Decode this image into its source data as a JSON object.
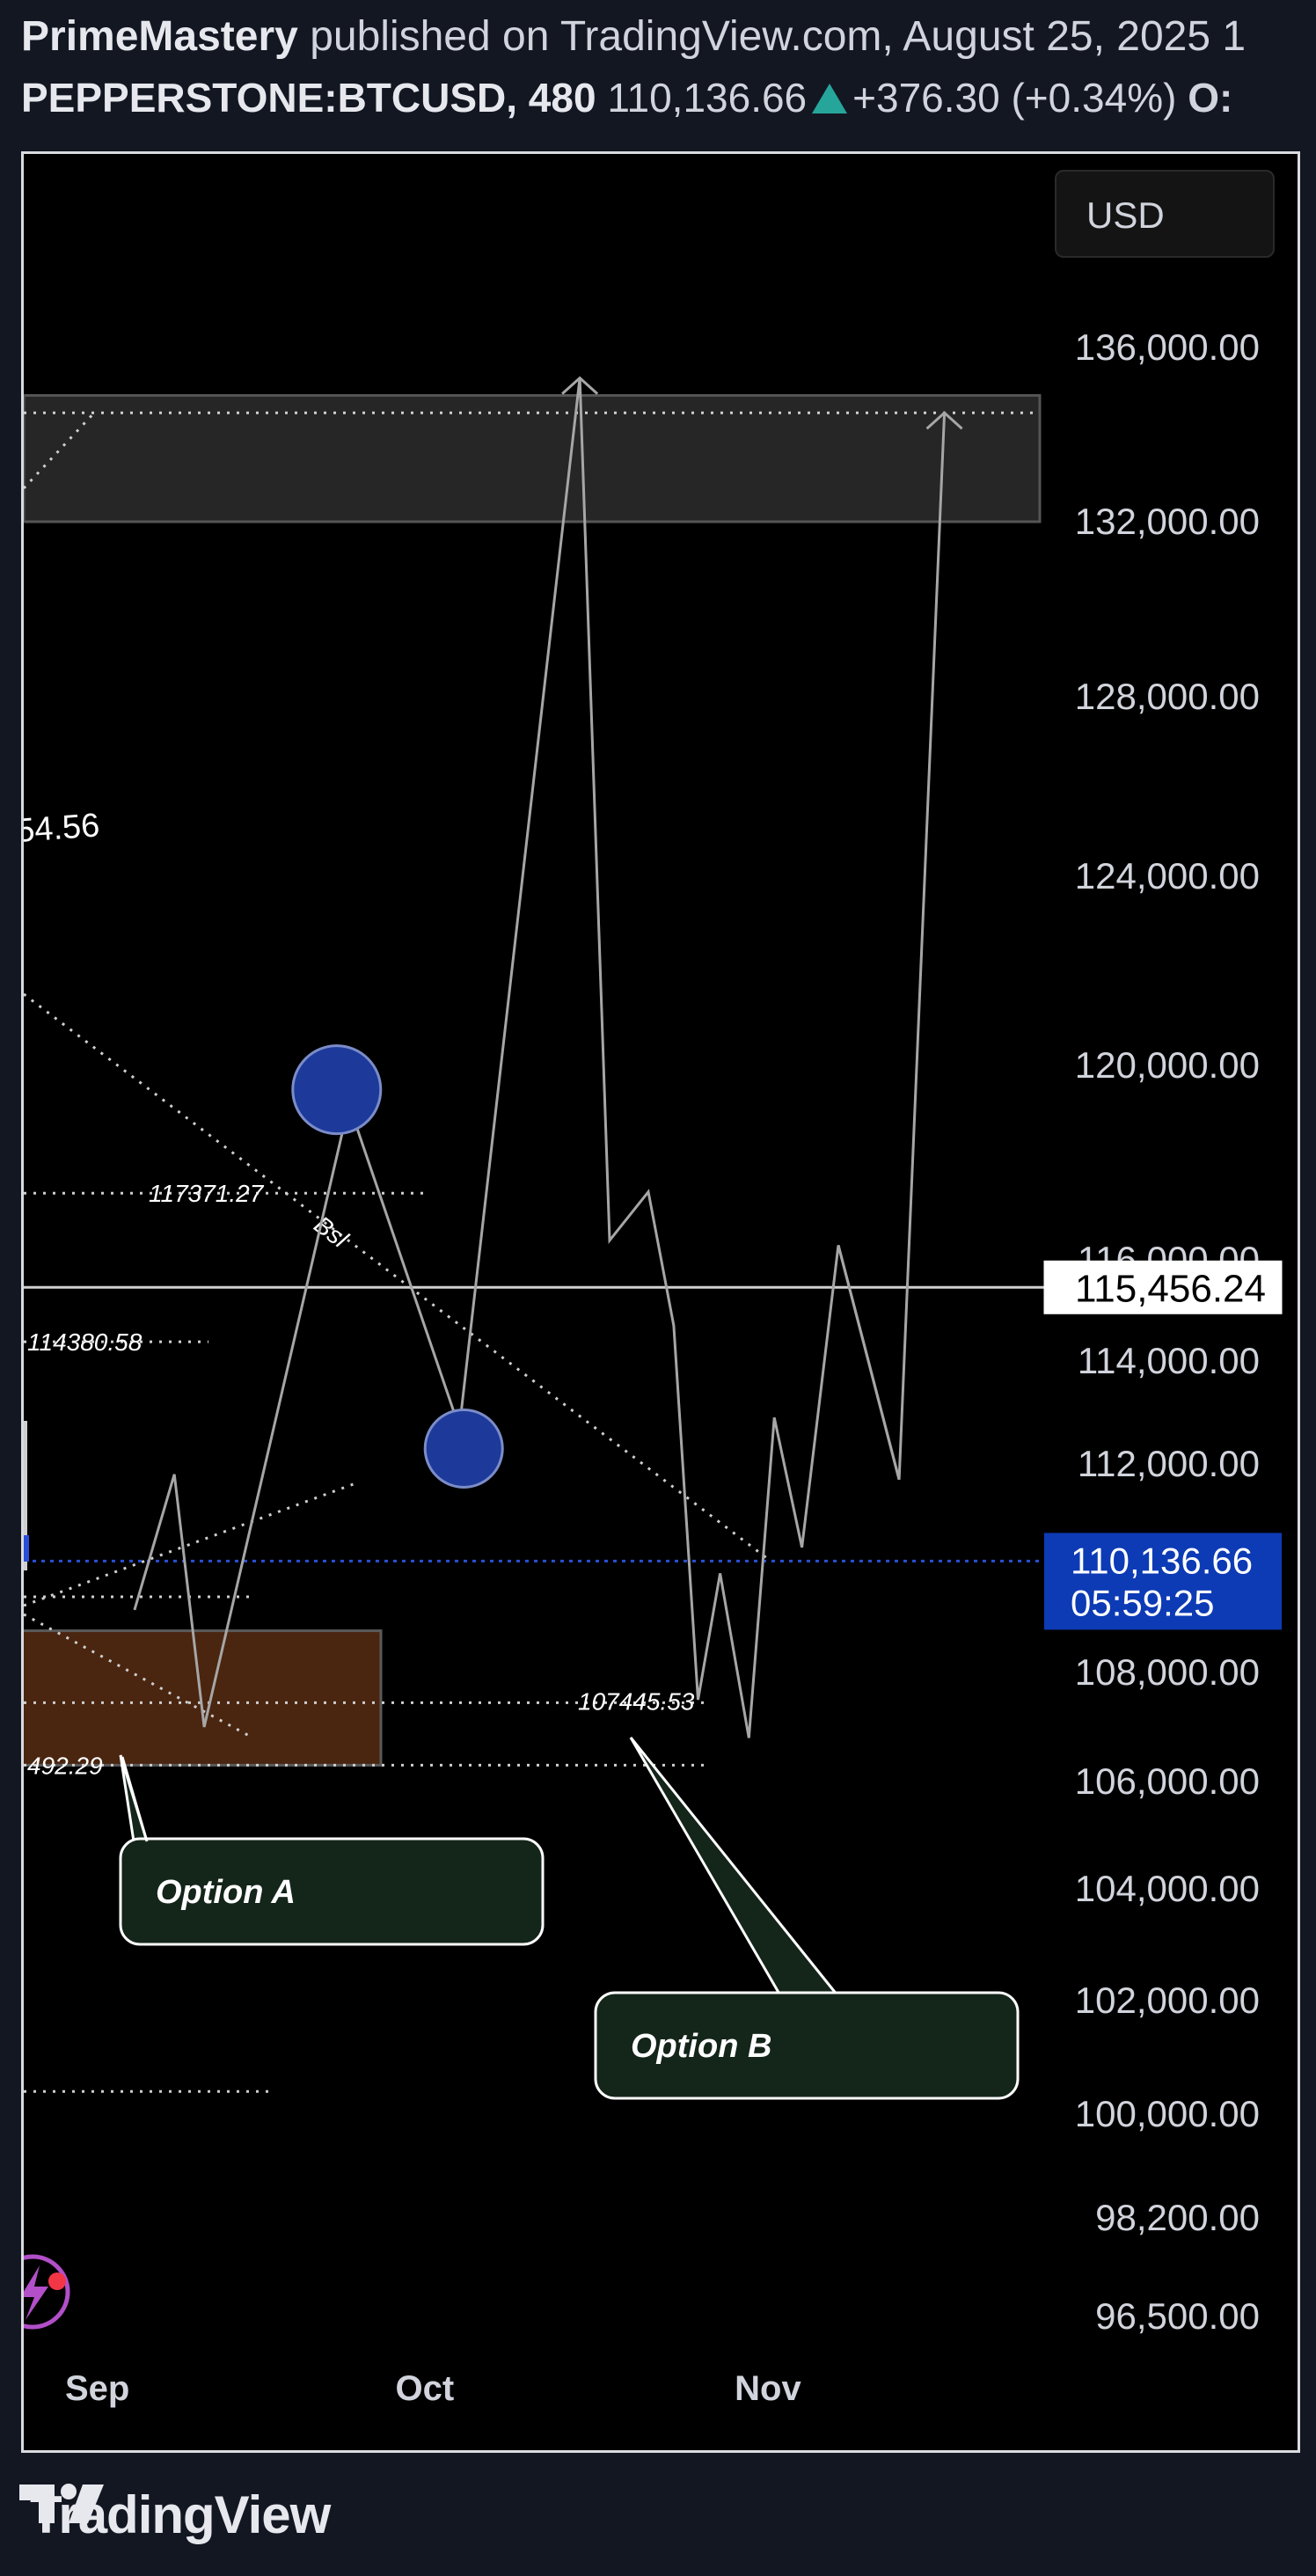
{
  "header": {
    "author": "PrimeMastery",
    "published_text": "published on TradingView.com, August 25, 2025 1",
    "symbol_interval": "PEPPERSTONE:BTCUSD, 480",
    "last_price": "110,136.66",
    "change": "+376.30 (+0.34%)",
    "ohlc_label": "O:"
  },
  "price_axis": {
    "unit": "USD",
    "labels": [
      {
        "text": "136,000.00",
        "value": 136000
      },
      {
        "text": "132,000.00",
        "value": 132000
      },
      {
        "text": "128,000.00",
        "value": 128000
      },
      {
        "text": "124,000.00",
        "value": 124000
      },
      {
        "text": "120,000.00",
        "value": 120000
      },
      {
        "text": "116,000.00",
        "value": 116000
      },
      {
        "text": "114,000.00",
        "value": 114000
      },
      {
        "text": "112,000.00",
        "value": 112000
      },
      {
        "text": "108,000.00",
        "value": 108000
      },
      {
        "text": "106,000.00",
        "value": 106000
      },
      {
        "text": "104,000.00",
        "value": 104000
      },
      {
        "text": "102,000.00",
        "value": 102000
      },
      {
        "text": "100,000.00",
        "value": 100000
      },
      {
        "text": "98,200.00",
        "value": 98200
      },
      {
        "text": "96,500.00",
        "value": 96500
      }
    ],
    "level_tag": {
      "text": "115,456.24",
      "value": 115456.24
    },
    "price_tag": {
      "price": "110,136.66",
      "countdown": "05:59:25",
      "value": 110136.66,
      "color": "#0d3bb5"
    }
  },
  "time_axis": {
    "labels": [
      {
        "text": "Sep",
        "t": 0.9
      },
      {
        "text": "Oct",
        "t": 30.8
      },
      {
        "text": "Nov",
        "t": 61.5
      }
    ]
  },
  "chart_data": {
    "type": "line",
    "series": [
      {
        "x": [
          4,
          7.6,
          10.3,
          23.4,
          33.4,
          44.3,
          47,
          50.5,
          52.8,
          55,
          57,
          59.6,
          61.9,
          64.4,
          67.7,
          73.2
        ],
        "y": [
          109200,
          111800,
          107000,
          119200,
          112700,
          135300,
          116400,
          117400,
          114700,
          107500,
          109900,
          106800,
          112900,
          110400,
          116300,
          111700
        ]
      },
      {
        "x": [
          67.7,
          73.2,
          77.3
        ],
        "y": [
          116300,
          111700,
          134500
        ]
      }
    ],
    "zones": [
      {
        "top": 134900,
        "bottom": 132000,
        "color": "#262626"
      },
      {
        "top": 108800,
        "bottom": 106300,
        "color": "#4a2510"
      }
    ],
    "levels": [
      {
        "label": "117371.27",
        "value": 117371.27
      },
      {
        "label": "114380.58",
        "value": 114380.58
      },
      {
        "label": "107445.53",
        "value": 107445.53
      },
      {
        "label": "492.29",
        "value": 106300
      },
      {
        "label": "54.56",
        "value": 123000
      },
      {
        "label": "",
        "value": 115456.24
      },
      {
        "label": "",
        "value": 100400
      },
      {
        "label": "",
        "value": 134500
      }
    ],
    "circles": [
      {
        "x": 22.3,
        "y": 119500
      },
      {
        "x": 33.8,
        "y": 112300
      }
    ],
    "trendline_label": "Bsl",
    "callouts": [
      {
        "text": "Option A"
      },
      {
        "text": "Option B"
      }
    ]
  }
}
